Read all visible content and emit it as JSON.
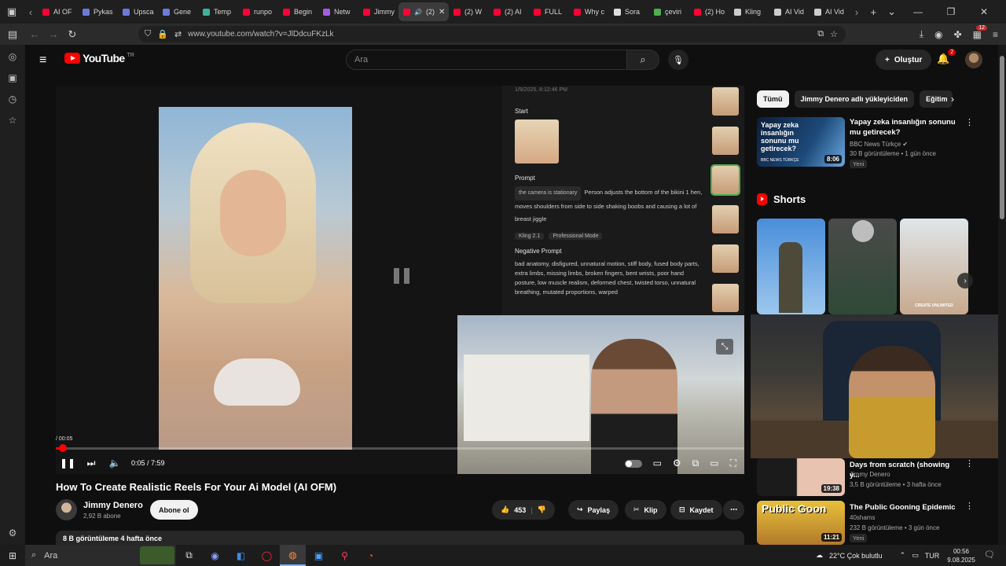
{
  "browser": {
    "tabs": [
      {
        "label": "AI OF",
        "color": "#ff0033"
      },
      {
        "label": "Pykas",
        "color": "#6c7bd9"
      },
      {
        "label": "Upsca",
        "color": "#6c7bd9"
      },
      {
        "label": "Gene",
        "color": "#6c7bd9"
      },
      {
        "label": "Temp",
        "color": "#3fb39a"
      },
      {
        "label": "runpo",
        "color": "#ff0033"
      },
      {
        "label": "Begin",
        "color": "#ff0033"
      },
      {
        "label": "Netw",
        "color": "#a45de0"
      },
      {
        "label": "Jimmy",
        "color": "#ff0033"
      },
      {
        "label": "(2)",
        "color": "#ff0033",
        "active": true
      },
      {
        "label": "(2) W",
        "color": "#ff0033"
      },
      {
        "label": "(2) AI",
        "color": "#ff0033"
      },
      {
        "label": "FULL",
        "color": "#ff0033"
      },
      {
        "label": "Why c",
        "color": "#ff0033"
      },
      {
        "label": "Sora",
        "color": "#dddddd"
      },
      {
        "label": "çeviri",
        "color": "#4caf50"
      },
      {
        "label": "(2) Ho",
        "color": "#ff0033"
      },
      {
        "label": "Kling",
        "color": "#cccccc"
      },
      {
        "label": "AI Vid",
        "color": "#cccccc"
      },
      {
        "label": "AI Vid",
        "color": "#cccccc"
      }
    ],
    "url": "www.youtube.com/watch?v=JlDdcuFKzLk",
    "extensions_badge": "12"
  },
  "youtube": {
    "logo_text": "YouTube",
    "country": "TR",
    "search_placeholder": "Ara",
    "create_label": "Oluştur",
    "notifications_count": "2"
  },
  "player": {
    "panel": {
      "timestamp": "1/9/2025, 8:12:46 PM",
      "start_label": "Start",
      "prompt_label": "Prompt",
      "prompt_tag": "the camera is stationary",
      "prompt_text": "Person adjusts the bottom of the bikini 1 hen, moves shoulders from side to side shaking boobs and causing a lot of breast jiggle",
      "model_chip": "Kling 2.1",
      "mode_chip": "Professional Mode",
      "negative_label": "Negative Prompt",
      "negative_text": "bad anatomy, disfigured, unnatural motion, stiff body, fused body parts, extra limbs, missing limbs, broken fingers, bent wrists, poor hand posture, low muscle realism, deformed chest, twisted torso, unnatural breathing, mutated proportions, warped"
    },
    "progress_label": "/ 00:05",
    "time": "0:05 / 7:59",
    "progress_fraction": 0.0104
  },
  "video": {
    "title": "How To Create Realistic Reels For Your Ai Model (AI OFM)",
    "channel": "Jimmy Denero",
    "subscribers": "2,92 B abone",
    "subscribe_label": "Abone ol",
    "likes": "453",
    "share_label": "Paylaş",
    "clip_label": "Klip",
    "save_label": "Kaydet",
    "description_meta": "8 B görüntüleme  4 hafta önce"
  },
  "sidebar": {
    "chips": [
      {
        "label": "Tümü",
        "active": true
      },
      {
        "label": "Jimmy Denero adlı yükleyiciden"
      },
      {
        "label": "Eğitim"
      }
    ],
    "recommendations": [
      {
        "title": "Yapay zeka insanlığın sonunu mu getirecek?",
        "channel": "BBC News Türkçe ✔",
        "meta": "30 B görüntüleme • 1 gün önce",
        "badge": "Yeni",
        "duration": "8:06",
        "thumb_text": "Yapay zeka insanlığın sonunu mu getirecek?",
        "thumb_brand": "BBC NEWS TÜRKÇE"
      },
      {
        "title": "Days from scratch (showing y...",
        "channel": "Jimmy Denero",
        "meta": "3,5 B görüntüleme • 3 hafta önce",
        "duration": "19:38"
      },
      {
        "title": "The Public Gooning Epidemic",
        "channel": "40shams",
        "meta": "232 B görüntüleme • 3 gün önce",
        "badge": "Yeni",
        "duration": "11:21",
        "thumb_text": "Public Goon"
      }
    ],
    "shorts_label": "Shorts",
    "short_caption": "CREATE UNLIMITED"
  },
  "taskbar": {
    "search_label": "Ara",
    "weather": "22°C  Çok bulutlu",
    "language": "TUR",
    "time": "00:56",
    "date": "9.08.2025"
  }
}
